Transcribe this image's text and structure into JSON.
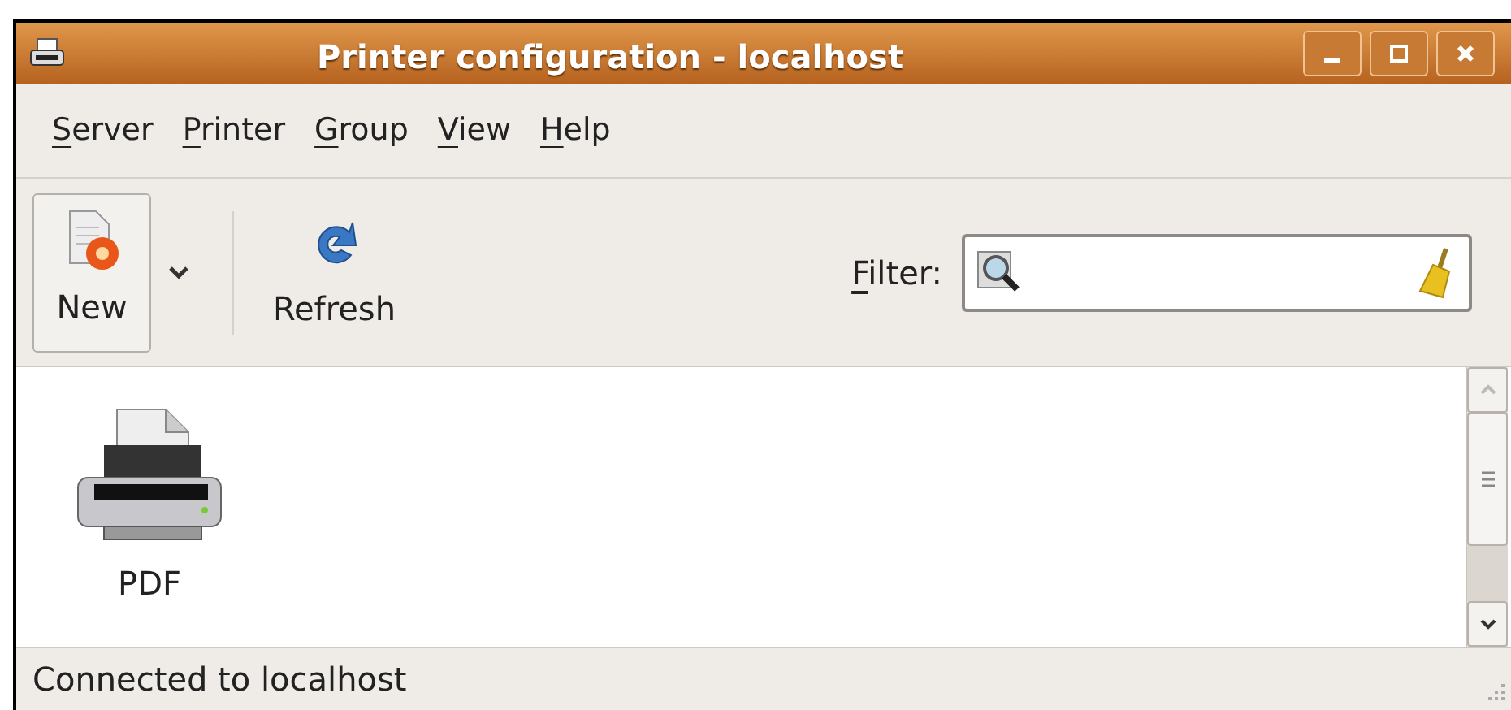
{
  "window": {
    "title": "Printer configuration - localhost"
  },
  "menu": [
    {
      "label": "Server",
      "mnemonic": true
    },
    {
      "label": "Printer",
      "mnemonic": true
    },
    {
      "label": "Group",
      "mnemonic": true
    },
    {
      "label": "View",
      "mnemonic": true
    },
    {
      "label": "Help",
      "mnemonic": true
    }
  ],
  "toolbar": {
    "new_button": {
      "label": "New"
    },
    "refresh_button": {
      "label": "Refresh"
    },
    "filter": {
      "label": "Filter:",
      "mnemonic": true
    }
  },
  "printers": [
    {
      "name": "PDF",
      "selected": false
    }
  ],
  "status_bar": "Connected to localhost"
}
